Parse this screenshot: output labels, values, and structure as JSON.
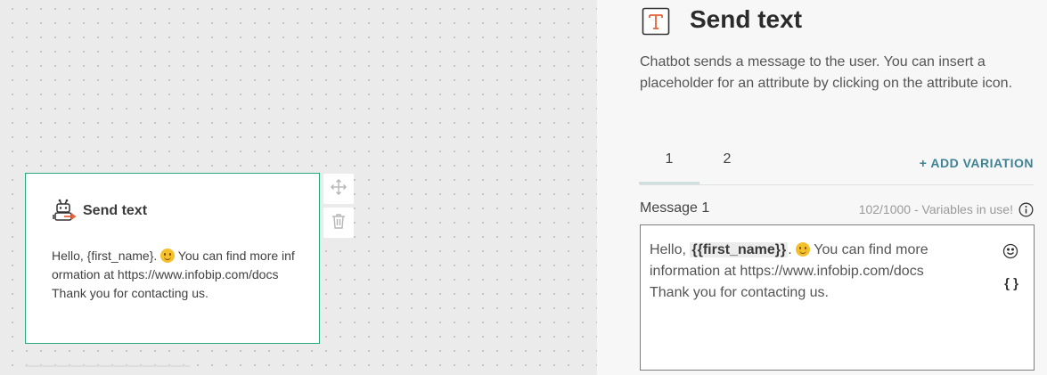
{
  "node": {
    "title": "Send text",
    "text_before": "Hello, {first_name}. ",
    "text_after": " You can find more information at https://www.infobip.com/docs",
    "text_line2": "Thank you for contacting us."
  },
  "panel": {
    "title": "Send text",
    "description": "Chatbot sends a message to the user. You can insert a placeholder for an attribute by clicking on the attribute icon.",
    "tabs": [
      "1",
      "2"
    ],
    "add_variation": "+ ADD VARIATION",
    "message_label": "Message 1",
    "char_count": "102/1000 - Variables in use!",
    "message": {
      "prefix": "Hello, ",
      "variable": "{{first_name}}",
      "suffix": ". ",
      "after_emoji": " You can find more information at https://www.infobip.com/docs",
      "line2": "Thank you for contacting us."
    },
    "attribute_button": "{ }"
  },
  "colors": {
    "node_border": "#2aa97a",
    "accent_link": "#3e8294",
    "icon_orange": "#e8623a"
  }
}
